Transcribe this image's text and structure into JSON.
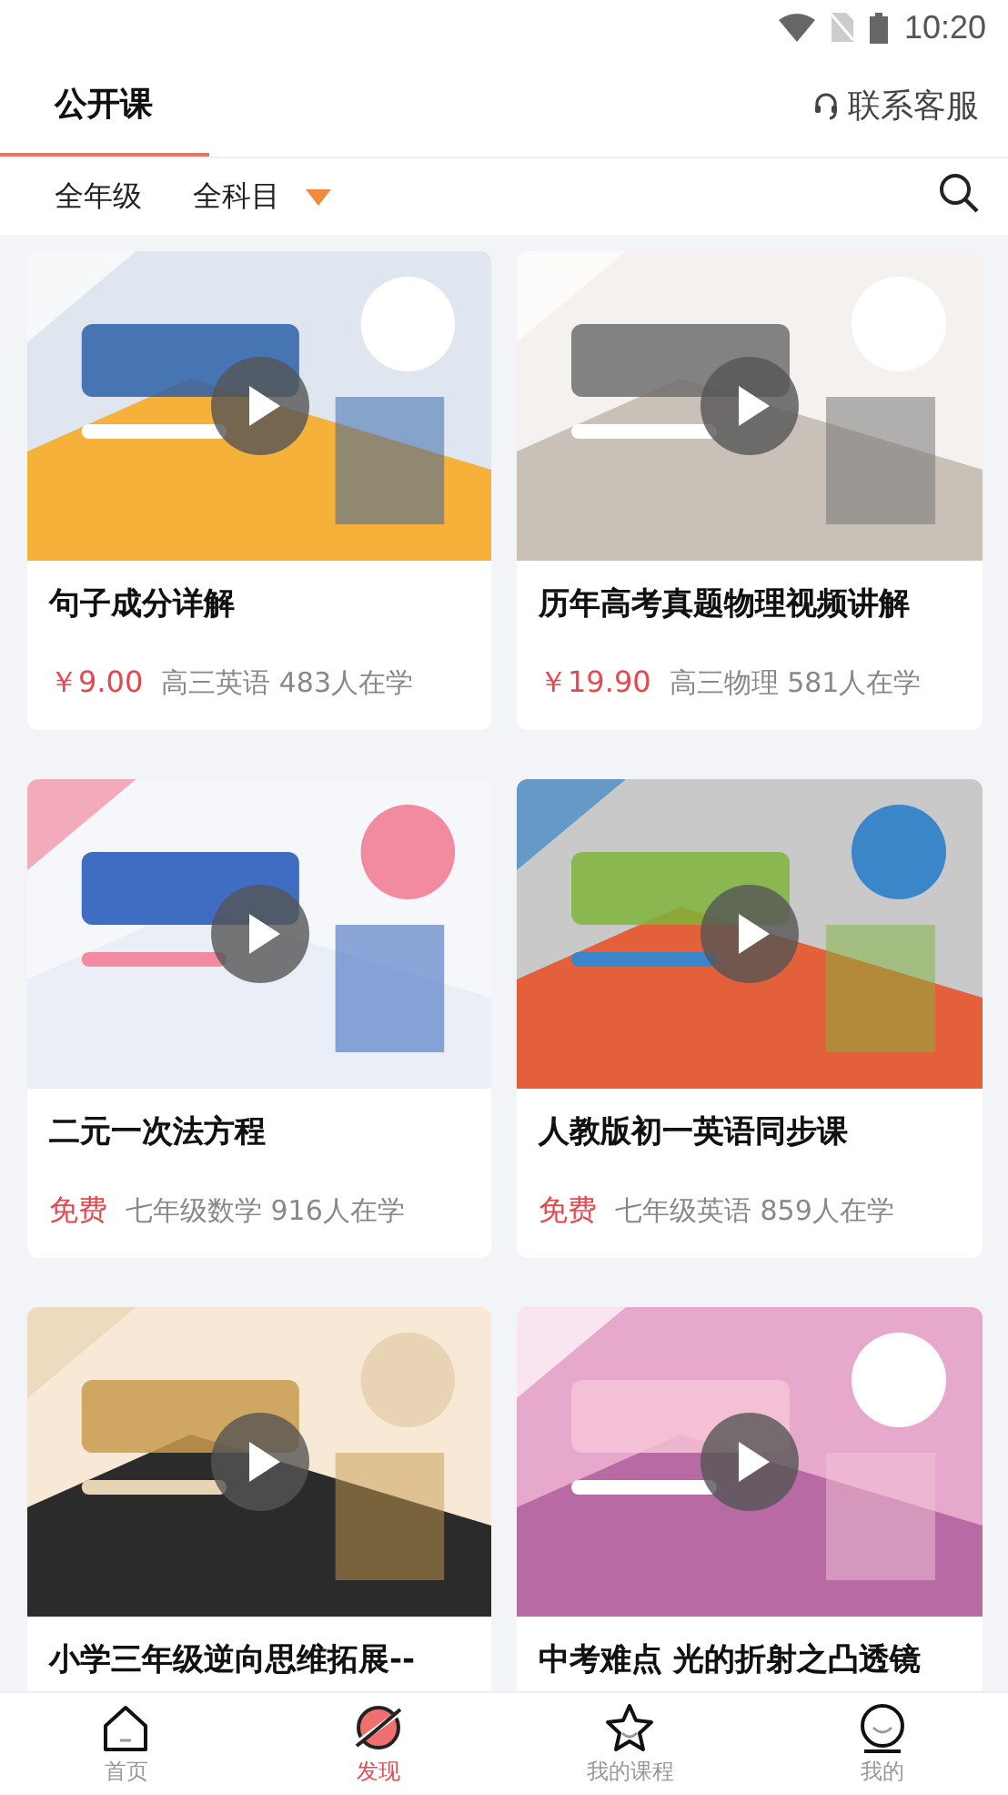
{
  "status_bar": {
    "time": "10:20"
  },
  "header": {
    "tabs": [
      {
        "label": "公开课",
        "selected": true
      }
    ],
    "service_link": "联系客服"
  },
  "filters": [
    {
      "label": "全年级",
      "dropdown": false
    },
    {
      "label": "全科目",
      "dropdown": true
    }
  ],
  "courses": [
    {
      "title": "句子成分详解",
      "price": "￥9.00",
      "meta": "高三英语 483人在学"
    },
    {
      "title": "历年高考真题物理视频讲解",
      "price": "￥19.90",
      "meta": "高三物理 581人在学"
    },
    {
      "title": "二元一次法方程",
      "price": "免费",
      "meta": "七年级数学 916人在学"
    },
    {
      "title": "人教版初一英语同步课",
      "price": "免费",
      "meta": "七年级英语 859人在学"
    },
    {
      "title": "小学三年级逆向思维拓展--"
    },
    {
      "title": "中考难点 光的折射之凸透镜"
    }
  ],
  "bottom_nav": [
    {
      "label": "首页",
      "selected": false
    },
    {
      "label": "发现",
      "selected": true
    },
    {
      "label": "我的课程",
      "selected": false
    },
    {
      "label": "我的",
      "selected": false
    }
  ]
}
